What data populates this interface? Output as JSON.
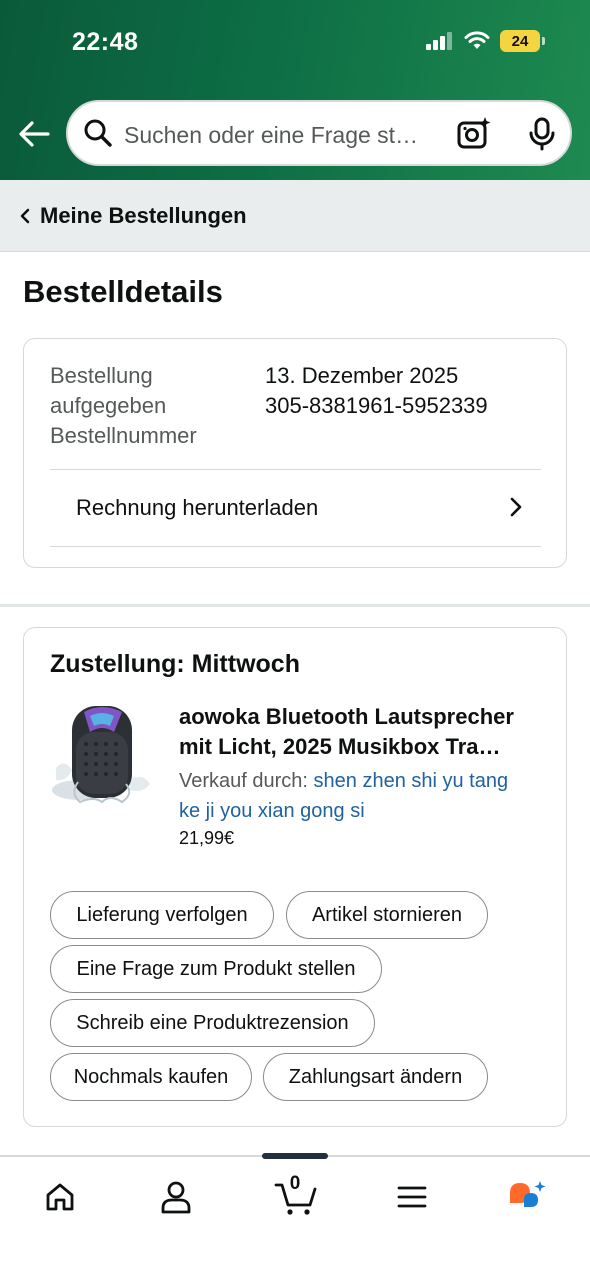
{
  "status_bar": {
    "time": "22:48",
    "battery": "24"
  },
  "search": {
    "placeholder": "Suchen oder eine Frage st…"
  },
  "breadcrumb": {
    "label": "Meine Bestellungen"
  },
  "page": {
    "title": "Bestelldetails"
  },
  "order": {
    "labels": [
      "Bestellung",
      "aufgegeben",
      "Bestellnummer"
    ],
    "date": "13. Dezember 2025",
    "number": "305-8381961-5952339",
    "invoice_label": "Rechnung herunterladen"
  },
  "delivery": {
    "title": "Zustellung: Mittwoch",
    "product": {
      "title_line1": "aowoka Bluetooth Lautsprecher",
      "title_line2": "mit Licht, 2025 Musikbox Tra…",
      "seller_prefix": "Verkauf durch: ",
      "seller_line1": "shen zhen shi yu tang",
      "seller_line2": "ke ji you xian gong si",
      "price": "21,99€",
      "image": "bluetooth-speaker-image"
    },
    "actions": {
      "track": "Lieferung verfolgen",
      "cancel": "Artikel stornieren",
      "ask": "Eine Frage zum Produkt stellen",
      "review": "Schreib eine Produktrezension",
      "buy_again": "Nochmals kaufen",
      "payment": "Zahlungsart ändern"
    }
  },
  "bottom_nav": {
    "items": [
      "home-icon",
      "account-icon",
      "cart-icon",
      "menu-icon",
      "rufus-icon"
    ],
    "cart_count": "0"
  },
  "colors": {
    "header_green": "#0d6e45",
    "link_blue": "#2162a1",
    "text": "#0f1111",
    "secondary": "#565959"
  }
}
